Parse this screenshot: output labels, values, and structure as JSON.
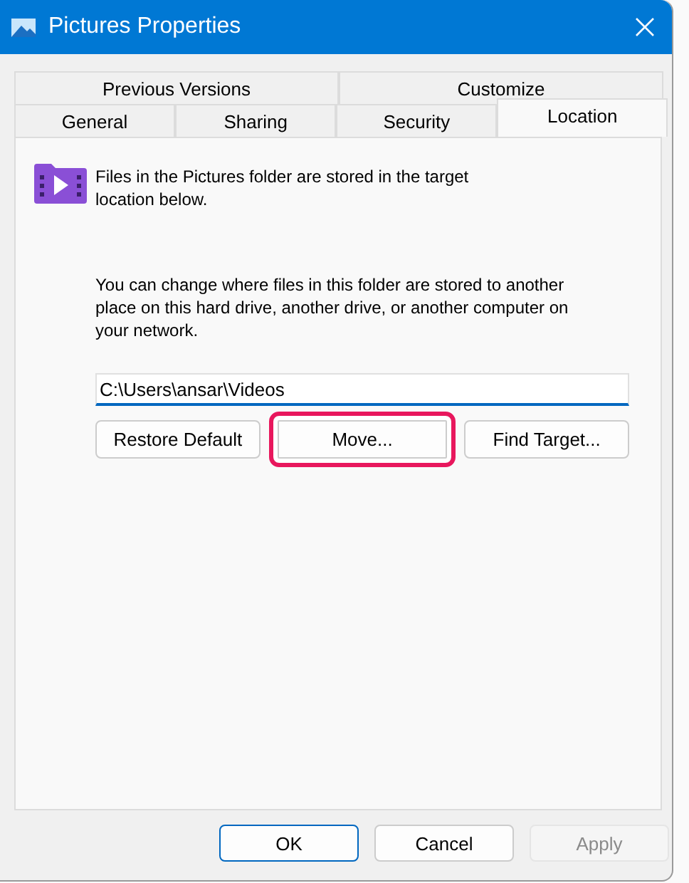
{
  "window": {
    "title": "Pictures Properties"
  },
  "tab_rows": [
    {
      "tabs": [
        {
          "label": "Previous Versions",
          "selected": false
        },
        {
          "label": "Customize",
          "selected": false
        }
      ]
    },
    {
      "tabs": [
        {
          "label": "General",
          "selected": false
        },
        {
          "label": "Sharing",
          "selected": false
        },
        {
          "label": "Security",
          "selected": false
        },
        {
          "label": "Location",
          "selected": true
        }
      ]
    }
  ],
  "location": {
    "description": "Files in the Pictures folder are stored in the target location below.",
    "info": "You can change where files in this folder are stored to another place on this hard drive, another drive, or another computer on your network.",
    "path": "C:\\Users\\ansar\\Videos",
    "buttons": [
      {
        "label": "Restore Default",
        "highlighted": false
      },
      {
        "label": "Move...",
        "highlighted": true
      },
      {
        "label": "Find Target...",
        "highlighted": false
      }
    ]
  },
  "dialog_buttons": [
    {
      "label": "OK",
      "default": true,
      "disabled": false
    },
    {
      "label": "Cancel",
      "default": false,
      "disabled": false
    },
    {
      "label": "Apply",
      "default": false,
      "disabled": true
    }
  ]
}
